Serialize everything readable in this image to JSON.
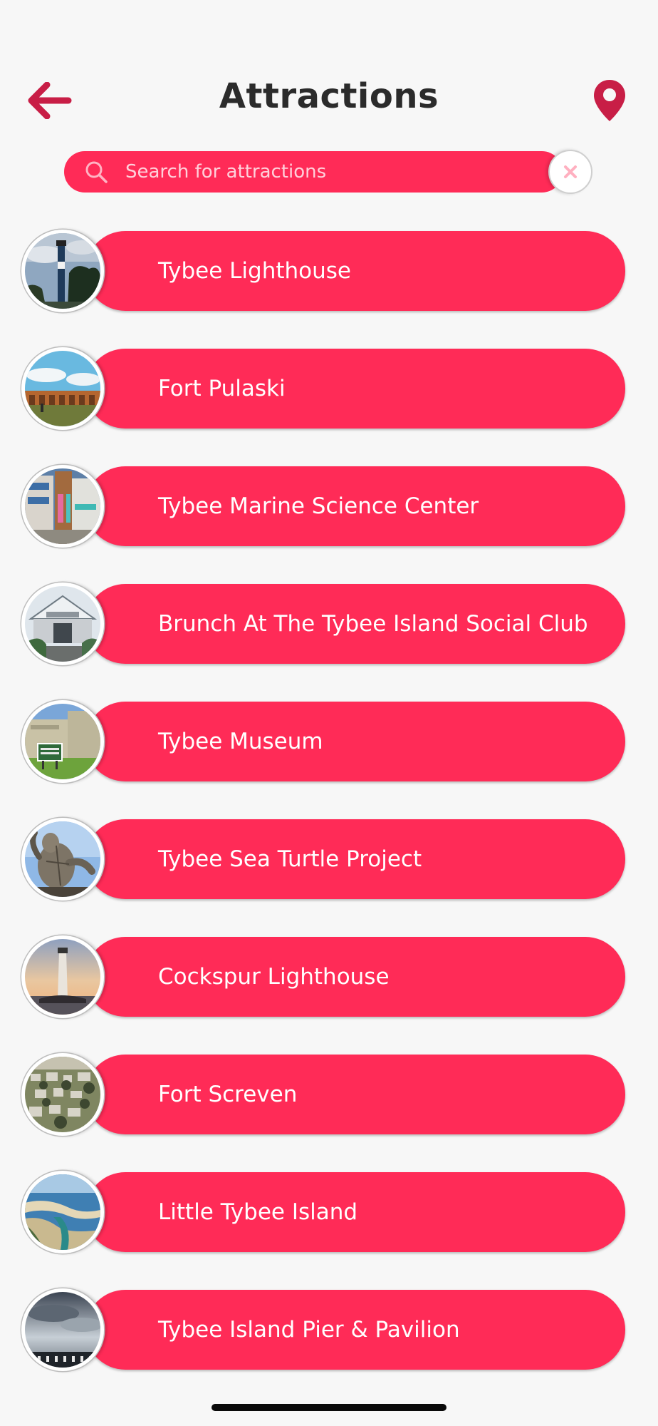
{
  "header": {
    "title": "Attractions",
    "back_icon": "arrow-left-icon",
    "map_icon": "map-pin-icon"
  },
  "search": {
    "placeholder": "Search for attractions",
    "value": "",
    "search_icon": "magnifier-icon",
    "clear_icon": "close-icon"
  },
  "colors": {
    "accent": "#ff2b57",
    "background": "#f7f7f7",
    "title_text": "#2b2b2b"
  },
  "attractions": [
    {
      "label": "Tybee Lighthouse",
      "thumb": "lighthouse-photo"
    },
    {
      "label": "Fort Pulaski",
      "thumb": "fort-arches-photo"
    },
    {
      "label": "Tybee Marine Science Center",
      "thumb": "building-photo"
    },
    {
      "label": "Brunch At The Tybee Island Social Club",
      "thumb": "club-building-photo"
    },
    {
      "label": "Tybee Museum",
      "thumb": "museum-photo"
    },
    {
      "label": "Tybee Sea Turtle Project",
      "thumb": "sea-turtle-photo"
    },
    {
      "label": "Cockspur Lighthouse",
      "thumb": "sunset-lighthouse-photo"
    },
    {
      "label": "Fort Screven",
      "thumb": "aerial-town-photo"
    },
    {
      "label": "Little Tybee Island",
      "thumb": "island-aerial-photo"
    },
    {
      "label": "Tybee Island Pier & Pavilion",
      "thumb": "pier-sky-photo"
    }
  ]
}
